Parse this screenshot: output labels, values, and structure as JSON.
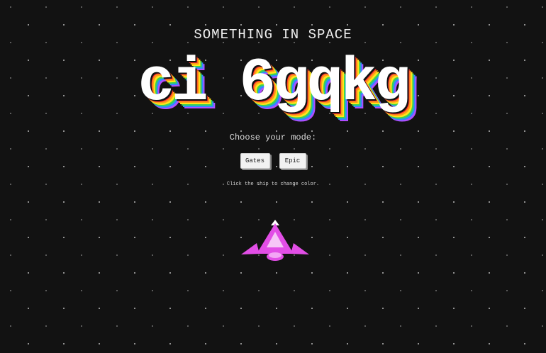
{
  "game": {
    "subtitle": "SOMETHING IN SPACE",
    "title": "ci 6gqkg",
    "mode_prompt": "Choose your mode:",
    "modes": [
      "Gates",
      "Epic"
    ],
    "hint": "Click the ship to change color.",
    "ship_color": "#e24ee6"
  },
  "colors": {
    "background": "#121212",
    "title_rainbow": [
      "#ff2d2d",
      "#ff9a1a",
      "#ffe61a",
      "#39d353",
      "#2e8cff",
      "#b04dff"
    ]
  }
}
